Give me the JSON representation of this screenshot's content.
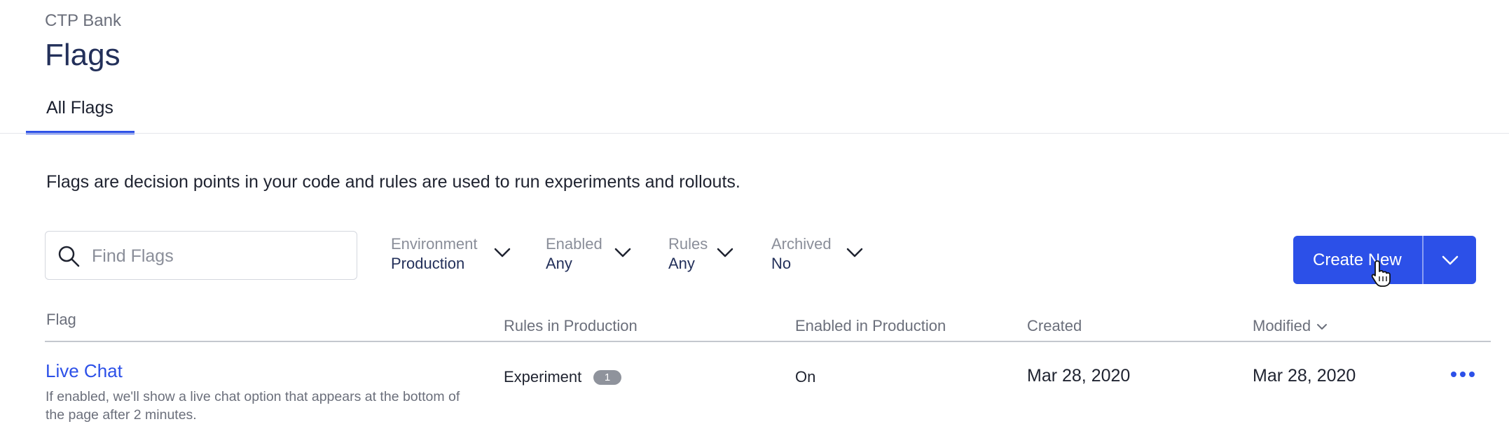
{
  "header": {
    "project_name": "CTP Bank",
    "page_title": "Flags"
  },
  "tabs": [
    {
      "label": "All Flags",
      "active": true
    }
  ],
  "description": "Flags are decision points in your code and rules are used to run experiments and rollouts.",
  "search": {
    "placeholder": "Find Flags",
    "value": ""
  },
  "filters": [
    {
      "label": "Environment",
      "value": "Production"
    },
    {
      "label": "Enabled",
      "value": "Any"
    },
    {
      "label": "Rules",
      "value": "Any"
    },
    {
      "label": "Archived",
      "value": "No"
    }
  ],
  "create_button": {
    "label": "Create New"
  },
  "table": {
    "columns": [
      "Flag",
      "Rules in Production",
      "Enabled in Production",
      "Created",
      "Modified"
    ],
    "sort_column": "Modified",
    "rows": [
      {
        "name": "Live Chat",
        "description": "If enabled, we'll show a live chat option that appears at the bottom of the page after 2 minutes.",
        "rule_type": "Experiment",
        "rule_count": "1",
        "enabled": "On",
        "created": "Mar 28, 2020",
        "modified": "Mar 28, 2020"
      }
    ]
  },
  "icons": {
    "search": "search-icon",
    "chevron": "chevron-down-icon",
    "more": "more-horizontal-icon",
    "cursor": "hand-pointer-icon"
  },
  "colors": {
    "accent": "#2c50e8",
    "title": "#23305a",
    "muted": "#8a8e99"
  }
}
